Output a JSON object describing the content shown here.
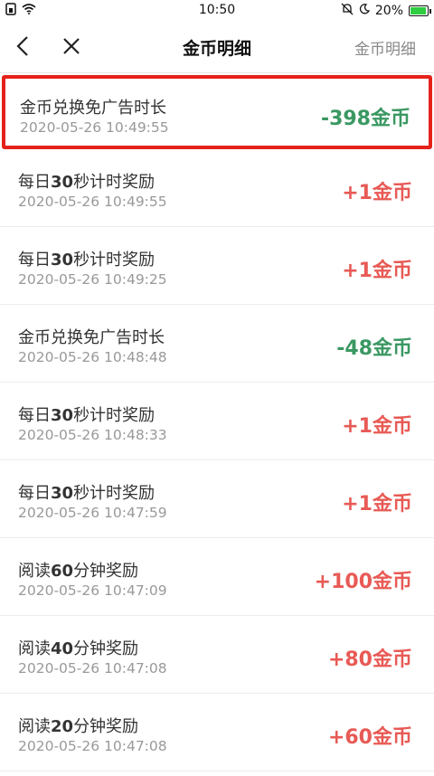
{
  "status": {
    "time": "10:50",
    "battery": "20%"
  },
  "nav": {
    "title": "金币明细",
    "right": "金币明细"
  },
  "colors": {
    "accent_positive": "#e85a55",
    "accent_negative": "#3a9862",
    "highlight_border": "#e5221a"
  },
  "items": [
    {
      "title_pre": "金币兑换免广告时长",
      "title_num": "",
      "title_post": "",
      "time": "2020-05-26 10:49:55",
      "amount": "-398金币",
      "type": "neg"
    },
    {
      "title_pre": "每日",
      "title_num": "30",
      "title_post": "秒计时奖励",
      "time": "2020-05-26 10:49:55",
      "amount": "+1金币",
      "type": "pos"
    },
    {
      "title_pre": "每日",
      "title_num": "30",
      "title_post": "秒计时奖励",
      "time": "2020-05-26 10:49:25",
      "amount": "+1金币",
      "type": "pos"
    },
    {
      "title_pre": "金币兑换免广告时长",
      "title_num": "",
      "title_post": "",
      "time": "2020-05-26 10:48:48",
      "amount": "-48金币",
      "type": "neg"
    },
    {
      "title_pre": "每日",
      "title_num": "30",
      "title_post": "秒计时奖励",
      "time": "2020-05-26 10:48:33",
      "amount": "+1金币",
      "type": "pos"
    },
    {
      "title_pre": "每日",
      "title_num": "30",
      "title_post": "秒计时奖励",
      "time": "2020-05-26 10:47:59",
      "amount": "+1金币",
      "type": "pos"
    },
    {
      "title_pre": "阅读",
      "title_num": "60",
      "title_post": "分钟奖励",
      "time": "2020-05-26 10:47:09",
      "amount": "+100金币",
      "type": "pos"
    },
    {
      "title_pre": "阅读",
      "title_num": "40",
      "title_post": "分钟奖励",
      "time": "2020-05-26 10:47:08",
      "amount": "+80金币",
      "type": "pos"
    },
    {
      "title_pre": "阅读",
      "title_num": "20",
      "title_post": "分钟奖励",
      "time": "2020-05-26 10:47:08",
      "amount": "+60金币",
      "type": "pos"
    }
  ]
}
